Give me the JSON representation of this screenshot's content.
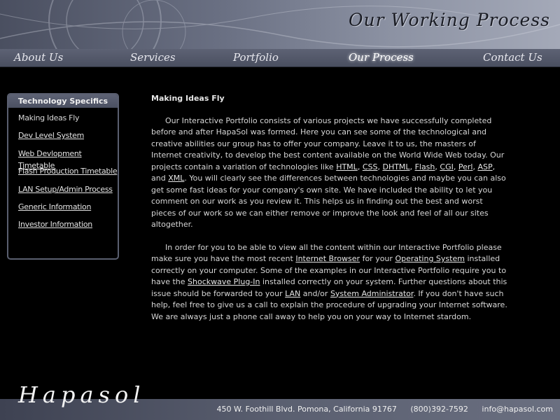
{
  "header": {
    "title": "Our Working Process"
  },
  "nav": {
    "items": [
      {
        "label": "About Us"
      },
      {
        "label": "Services"
      },
      {
        "label": "Portfolio"
      },
      {
        "label": "Our Process"
      },
      {
        "label": "Contact Us"
      }
    ],
    "active": "Our Process"
  },
  "sidebar": {
    "title": "Technology Specifics",
    "items": [
      {
        "label": "Making Ideas Fly"
      },
      {
        "label": "Dev Level System"
      },
      {
        "label": "Web Devlopment Timetable"
      },
      {
        "label": "Flash Production Timetable"
      },
      {
        "label": "LAN Setup/Admin Process"
      },
      {
        "label": "Generic Information"
      },
      {
        "label": "Investor Information"
      }
    ]
  },
  "main": {
    "heading": "Making Ideas Fly",
    "p1": {
      "t1": "Our Interactive Portfolio consists of various projects we have successfully completed before and after HapaSol was formed. Here you can see some of the technological and creative abilities our group has to offer your company. Leave it to us, the masters of Internet creativity, to develop the best content available on the World Wide Web today. Our projects contain a variation of technologies like ",
      "html": "HTML",
      "css": "CSS",
      "dhtml": "DHTML",
      "flash": "Flash",
      "cgi": "CGI",
      "perl": "Perl",
      "asp": "ASP",
      "sep_and": ", and ",
      "xml": "XML",
      "t2": ". You will clearly see the differences between technologies and maybe you can also get some fast ideas for your company's own site. We have included the ability to let you comment on our work as you review it. This helps us in finding out the best and worst pieces of our work so we can either remove or improve the look and feel of all our sites altogether."
    },
    "p2": {
      "t1": "In order for you to be able to view all the content within our Interactive Portfolio please make sure you have the most recent ",
      "internet_browser": "Internet Browser",
      "t2": " for your ",
      "operating_system": "Operating System",
      "t3": " installed correctly on your computer. Some of the examples in our Interactive Portfolio require you to have the ",
      "shockwave": "Shockwave Plug-In",
      "t4": " installed correctly on your system. Further questions about this issue should be forwarded to your ",
      "lan": "LAN",
      "t5": " and/or ",
      "sysadmin": "System Administrator",
      "t6": ". If you don't have such help, feel free to give us a call to explain the procedure of upgrading your Internet software. We are always just a phone call away to help you on your way to Internet stardom."
    }
  },
  "footer": {
    "logo": "Hapasol",
    "address": "450 W. Foothill Blvd. Pomona, California 91767",
    "phone": "(800)392-7592",
    "email": "info@hapasol.com"
  },
  "colors": {
    "background": "#000000",
    "bar": "#4a4f60",
    "text": "#d6d6d6"
  }
}
